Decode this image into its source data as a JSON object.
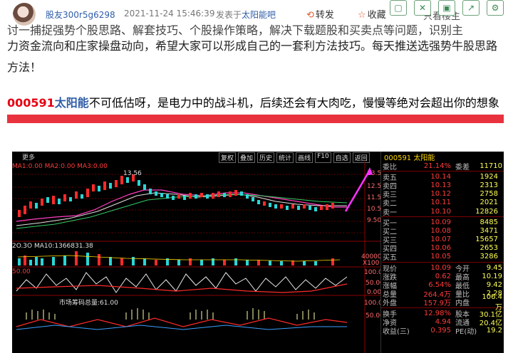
{
  "header": {
    "username": "股友300r5g6298",
    "time": "2021-11-24 15:46:39",
    "post_prefix": "发表于",
    "post_board": "太阳能吧",
    "share_label": "转发",
    "fav_label": "收藏",
    "behind_text": "只看楼主"
  },
  "article": {
    "line_cut": "讨一捕捉强势个股思路、解套技巧、个股操作策略，解决下载题股和买卖点等问题，识别主",
    "line2": "力资金流向和庄家操盘动向，希望大家可以形成自己的一套利方法技巧。每天推送选强势牛股思路",
    "line3": "方法！"
  },
  "stock_line": {
    "code": "000591",
    "name": "太阳能",
    "text": "不可低估呀，是电力中的战斗机，后续还会有大肉吃，慢慢等绝对会超出你的想象"
  },
  "screenshot": {
    "top_label": "更多",
    "menu": [
      "复权",
      "叠加",
      "历史",
      "统计",
      "画线",
      "F10",
      "自选",
      "返回"
    ],
    "price_labels": [
      "13.50",
      "12.50",
      "11.50",
      "10.50",
      "9.50"
    ],
    "high_marker": "13.56",
    "indicator_labels": {
      "ma_line": "MA1:0.00  MA2:0.00  MA3:0.00",
      "vol_line": "2O.3O  MA10:1366831.38",
      "mid_line": "50.00",
      "bottom_line": "市场筹码总量:61.00"
    },
    "vol_axis": [
      "40000",
      "X100"
    ],
    "osc_axis": [
      "100.00",
      "50.00",
      "0.00"
    ],
    "bottom_axis": [
      "100.00",
      "50.00"
    ],
    "quote": {
      "title_code": "000591",
      "title_name": "太阳能",
      "wei": {
        "label": "委比",
        "pct": "21.14%",
        "label2": "委差",
        "val": "11710"
      },
      "sell": [
        {
          "label": "卖五",
          "price": "10.14",
          "vol": "1924"
        },
        {
          "label": "卖四",
          "price": "10.13",
          "vol": "2313"
        },
        {
          "label": "卖三",
          "price": "10.12",
          "vol": "2758"
        },
        {
          "label": "卖二",
          "price": "10.11",
          "vol": "2021"
        },
        {
          "label": "卖一",
          "price": "10.10",
          "vol": "12826"
        }
      ],
      "buy": [
        {
          "label": "买一",
          "price": "10.09",
          "vol": "8485"
        },
        {
          "label": "买二",
          "price": "10.08",
          "vol": "3471"
        },
        {
          "label": "买三",
          "price": "10.07",
          "vol": "15657"
        },
        {
          "label": "买四",
          "price": "10.06",
          "vol": "2653"
        },
        {
          "label": "买五",
          "price": "10.05",
          "vol": "3286"
        }
      ],
      "stats": [
        {
          "l1": "现价",
          "v1": "10.09",
          "l2": "今开",
          "v2": "9.45"
        },
        {
          "l1": "涨跌",
          "v1": "0.62",
          "l2": "最高",
          "v2": "10.19"
        },
        {
          "l1": "涨幅",
          "v1": "6.54%",
          "l2": "最低",
          "v2": "9.42"
        },
        {
          "l1": "总量",
          "v1": "264.4万",
          "l2": "量比",
          "v2": "2.28"
        },
        {
          "l1": "外盘",
          "v1": "157.9万",
          "l2": "内盘",
          "v2": "106.4万"
        }
      ],
      "stats2": [
        {
          "l1": "换手",
          "v1": "12.98%",
          "l2": "股本",
          "v2": "30.1亿"
        },
        {
          "l1": "净资",
          "v1": "4.94",
          "l2": "流通",
          "v2": "20.4亿"
        },
        {
          "l1": "收益(三)",
          "v1": "0.395",
          "l2": "PE(动)",
          "v2": "19.2"
        }
      ]
    }
  }
}
